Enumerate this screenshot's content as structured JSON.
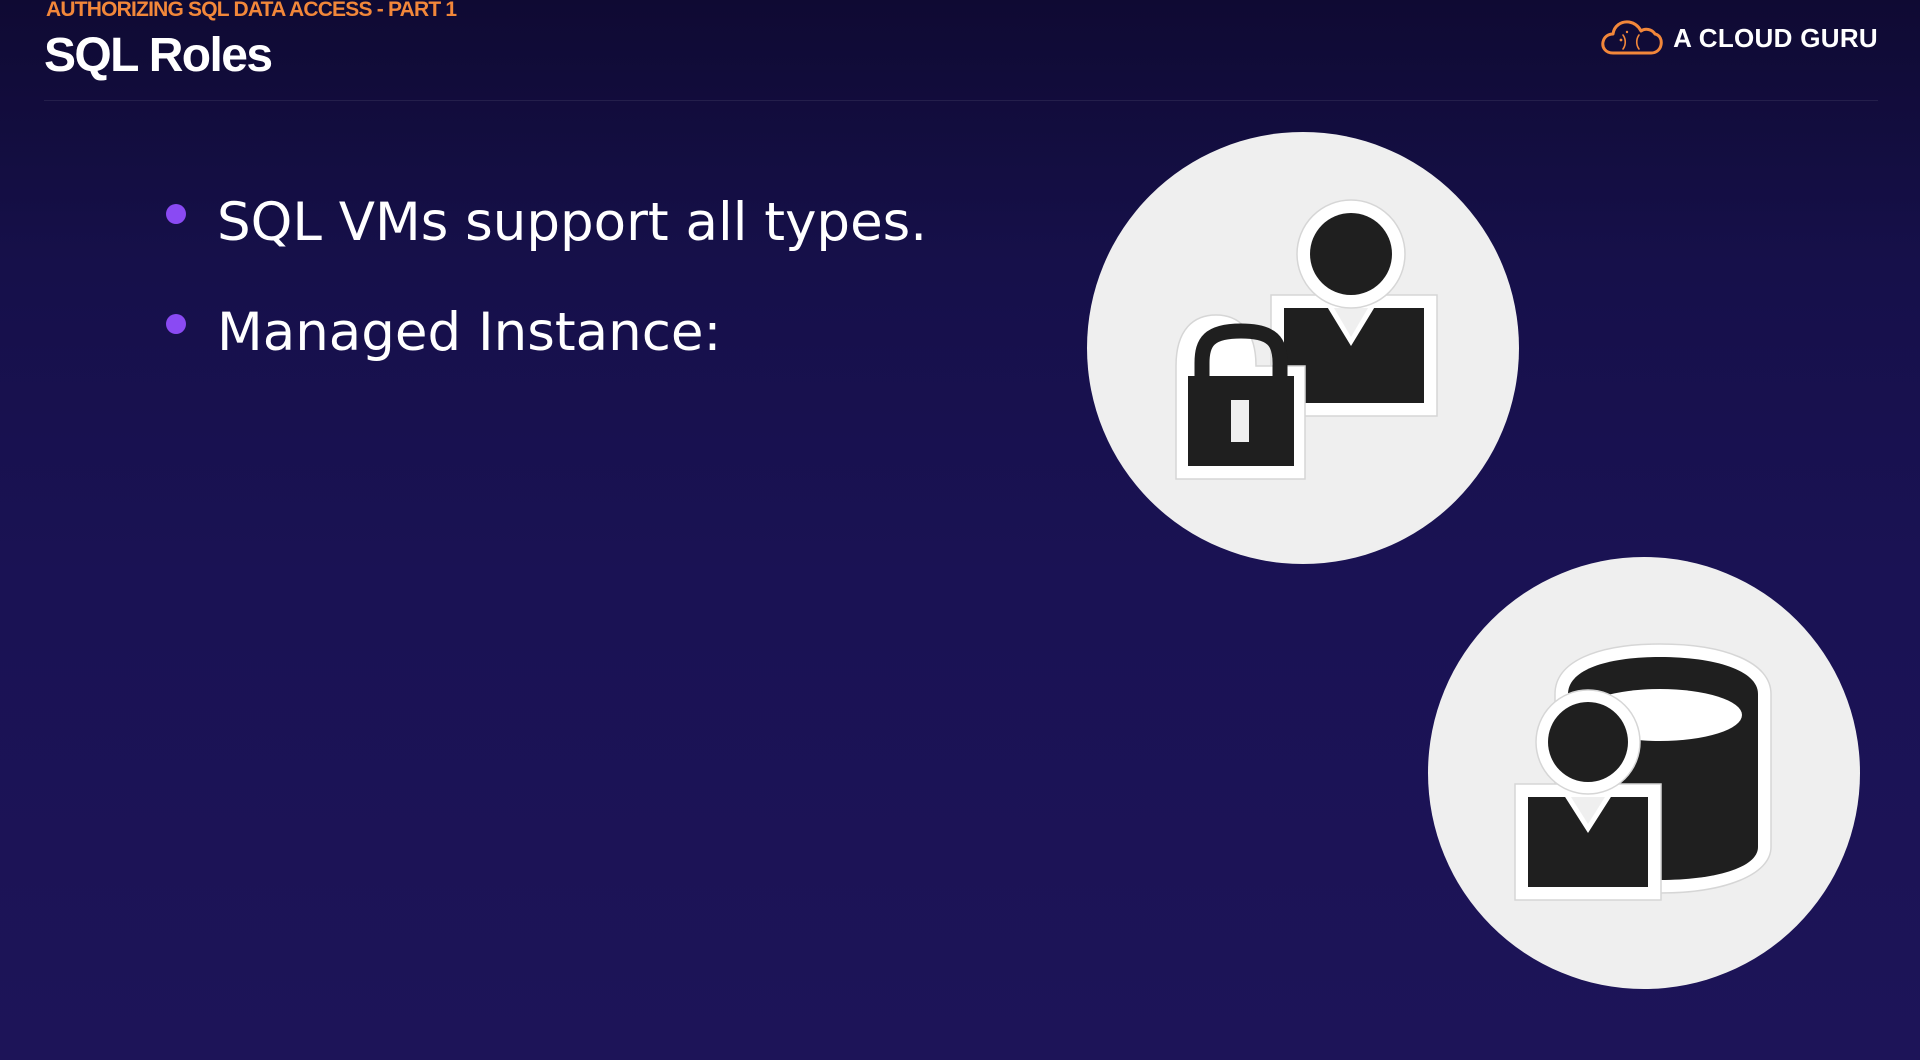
{
  "header": {
    "eyebrow": "AUTHORIZING SQL DATA ACCESS - PART 1",
    "title": "SQL Roles"
  },
  "brand": {
    "name": "A CLOUD GURU",
    "logo_icon": "cloud-logo-icon",
    "accent": "#f2873a"
  },
  "bullets": [
    {
      "text": "SQL VMs support all types."
    },
    {
      "text": "Managed Instance:"
    }
  ],
  "icons": [
    {
      "name": "user-lock-icon"
    },
    {
      "name": "database-user-icon"
    }
  ],
  "colors": {
    "background_top": "#0f0a33",
    "background_bottom": "#1d1458",
    "bullet": "#8a4af3",
    "eyebrow": "#f2873a",
    "circle": "#efefef",
    "icon": "#1f1f1f"
  }
}
